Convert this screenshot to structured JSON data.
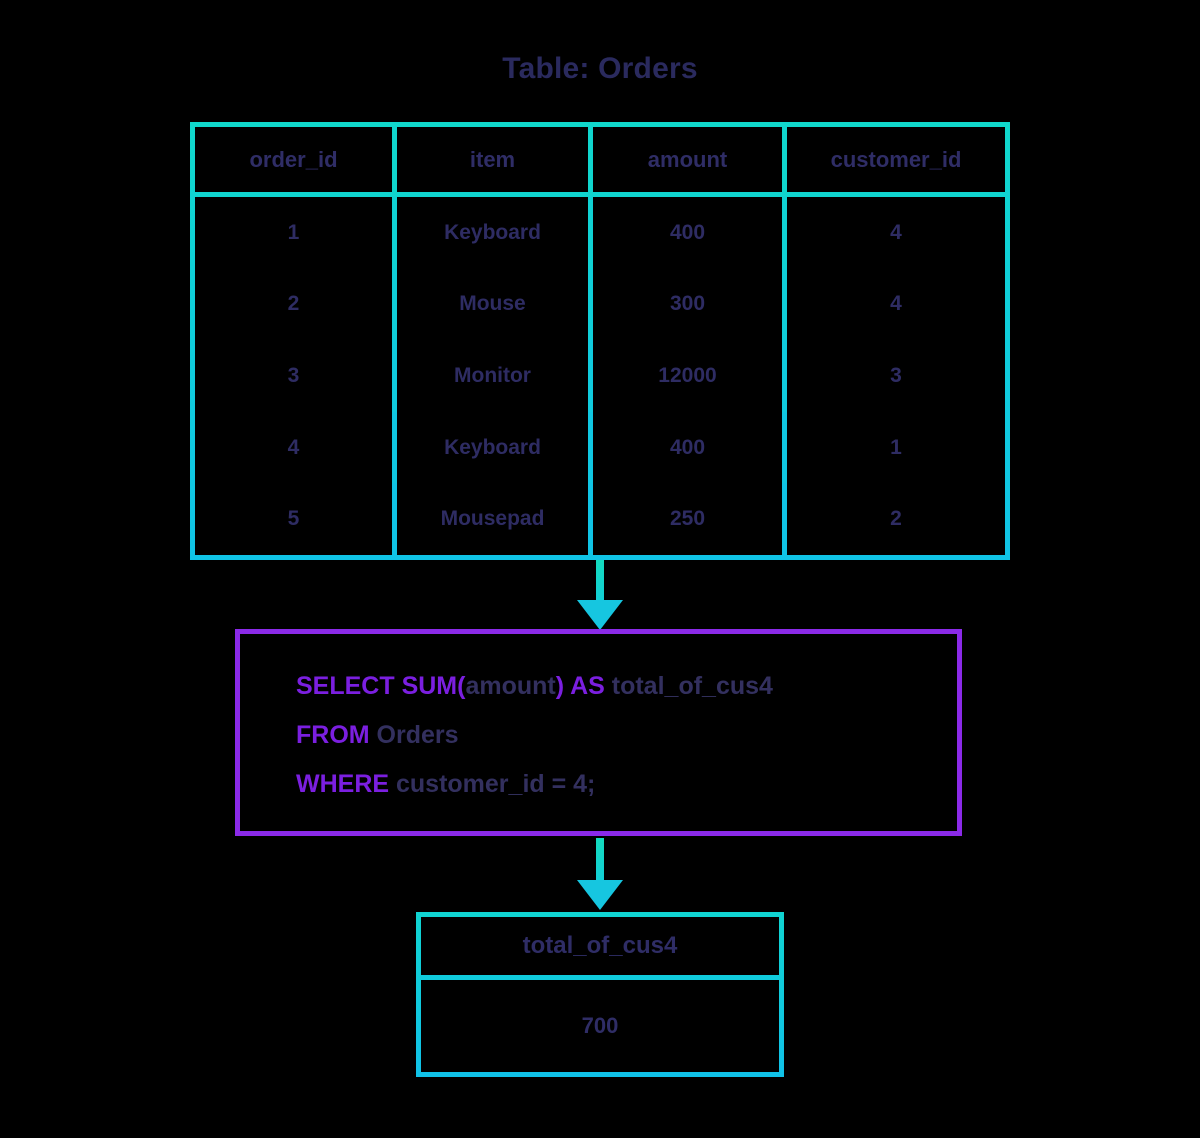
{
  "title": "Table: Orders",
  "source_table": {
    "name": "Orders",
    "columns": [
      "order_id",
      "item",
      "amount",
      "customer_id"
    ],
    "rows": [
      [
        "1",
        "Keyboard",
        "400",
        "4"
      ],
      [
        "2",
        "Mouse",
        "300",
        "4"
      ],
      [
        "3",
        "Monitor",
        "12000",
        "3"
      ],
      [
        "4",
        "Keyboard",
        "400",
        "1"
      ],
      [
        "5",
        "Mousepad",
        "250",
        "2"
      ]
    ]
  },
  "query": {
    "line1": {
      "kw1": "SELECT SUM(",
      "arg1": "amount",
      "kw2": ") AS ",
      "alias": "total_of_cus4"
    },
    "line2": {
      "kw1": "FROM ",
      "arg1": "Orders"
    },
    "line3": {
      "kw1": "WHERE ",
      "arg1": "customer_id = 4;"
    },
    "full_text": "SELECT SUM(amount) AS total_of_cus4 FROM Orders WHERE customer_id = 4;"
  },
  "result_table": {
    "column": "total_of_cus4",
    "value": "700"
  },
  "arrows": [
    {
      "name": "table-to-query-arrow",
      "direction": "down"
    },
    {
      "name": "query-to-result-arrow",
      "direction": "down"
    }
  ],
  "colors": {
    "accent_teal": "#10d6ce",
    "accent_cyan": "#10c4e6",
    "accent_purple": "#8b2ae8",
    "text_navy": "#2f2d66",
    "background": "#000000"
  }
}
